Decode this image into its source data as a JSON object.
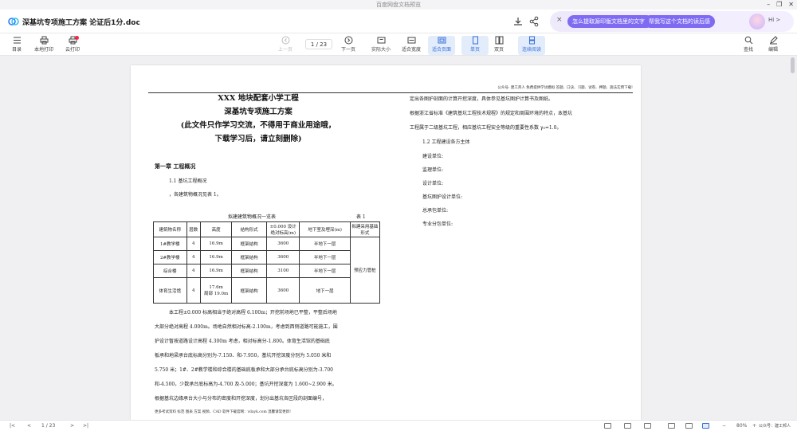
{
  "window": {
    "title": "百度网盘文档预览",
    "minimize": "–",
    "restore": "❐",
    "close": "✕"
  },
  "doc": {
    "title": "深基坑专项施工方案 论证后1分.doc"
  },
  "assistant": {
    "close": "×",
    "question1": "怎么提取源印版文档里的文字?",
    "question2": "帮我写这个文档的读后感",
    "greeting": "Hi >"
  },
  "toolbar": {
    "toc": "目录",
    "local_print": "本地打印",
    "cloud_print": "云打印",
    "prev": "上一页",
    "page_indicator": "1 / 23",
    "next": "下一页",
    "actual_size": "实际大小",
    "fit_width": "适合宽度",
    "fit_page": "适合页面",
    "single_page": "单页",
    "double_page": "双页",
    "continuous": "连续阅读",
    "search": "查找",
    "edit": "编辑"
  },
  "page": {
    "header_note": "公众号: 建工邦人 免费提供学试模拟 答题、口诀、习题、试卷、押题、施法实用下载!",
    "title1": "XXX 地块配套小学工程",
    "title2": "深基坑专项施工方案",
    "title3": "(此文件只作学习交流，不得用于商业用途哦，",
    "title4": "下载学习后，请立刻删除)",
    "chapter1": "第一章    工程概况",
    "sec1_1": "1.1    基坑工程概况",
    "intro": "，各建筑物概况见表 1。",
    "table_caption": "拟建建筑物概况一览表",
    "table_no": "表 1",
    "table_headers": [
      "建筑物名称",
      "层数",
      "高度",
      "结构形式",
      "±0.000 设计绝对标高(m)",
      "地下室及埋深(m)",
      "拟建采用基础形式"
    ],
    "table_rows": [
      [
        "1#教学楼",
        "4",
        "16.9m",
        "框架结构",
        "3600",
        "半地下一层"
      ],
      [
        "2#教学楼",
        "4",
        "16.9m",
        "框架结构",
        "3600",
        "半地下一层"
      ],
      [
        "综合楼",
        "4",
        "16.9m",
        "框架结构",
        "3100",
        "半地下一层"
      ],
      [
        "体育生活馆",
        "4",
        "17.6m",
        "框架结构",
        "3600",
        "地下一层"
      ]
    ],
    "row4_height_extra": "局部 19.0m",
    "foundation": "预应力管桩",
    "para1": [
      "本工程±0.000 标高相当于绝对高程 6.100m；开挖前场地已平整，平整后场地",
      "大部分绝对高程 4.000m。场地自然相对标高-2.100m，考虑到西侧道路可能施工，围",
      "护设计暂按道路设计高程 4.300m 考虑，相对标高分-1.800。体育生活馆的基础底",
      "板承和地梁承台底标高分别为-7.150、和-7.950，基坑开挖深度分别为 5.050 米和",
      "5.750 米；1#、2#教学楼和综合楼的基础底板承和大部分承台底标高分别为-3.700",
      "和-4.500，少数承台底标高为-4.700 及-5.000；基坑开挖深度为 1.600~2.900 米。",
      "根据基坑边缘承台大小与分布的密度和开挖深度，划分出基坑各区段的剖面编号，"
    ],
    "right_para": [
      "定出各图护剖面的计算开挖深度，具体参见基坑图护计算书及图纸。",
      "    根据浙江省标准《建筑基坑工程技术规程》的规定和周围环境的特点，本基坑",
      "工程属于二级基坑工程，相应基坑工程安全等级的重要性系数 γ₀=1.0。"
    ],
    "sec1_2": "1.2    工程建设各方主体",
    "parties": [
      "建设单位:",
      "监理单位:",
      "设计单位:",
      "基坑图护设计单位:",
      "总承包单位:",
      "专业分包单位:"
    ],
    "footer": "更多考试资料 标范 图表 方案 视频、CAD 软件下载官网：vdayk.com 温馨请常更新!"
  },
  "statusbar": {
    "first": "|<",
    "prev": "<",
    "page": "1 / 23",
    "next": ">",
    "last": ">|",
    "zoom_minus": "−",
    "zoom": "80%",
    "zoom_plus": "+",
    "watermark": "公众号：建工邦人"
  },
  "colors": {
    "accent": "#3a6fd8",
    "assistant_pill": "#7e6bf2"
  }
}
